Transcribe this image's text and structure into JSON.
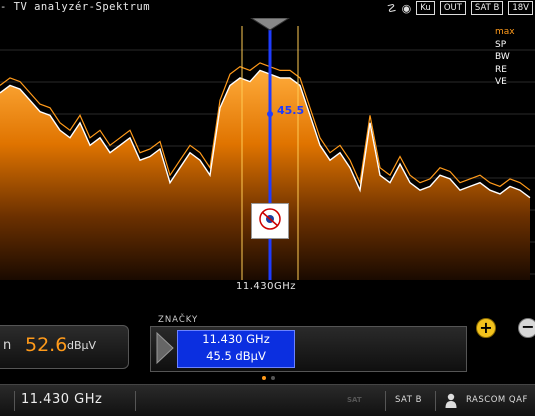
{
  "header": {
    "title": "- TV analyzér-Spektrum",
    "badges": [
      "Ku",
      "OUT",
      "SAT B",
      "18V"
    ]
  },
  "spectrum": {
    "center_frequency_label": "11.430GHz",
    "marker_readout": "45.5",
    "legend": [
      "max",
      "SP",
      "BW",
      "RE",
      "VE"
    ],
    "colors": {
      "fill": "#ff8c00",
      "max_trace": "#ff9a1a",
      "live_trace": "#ffffff",
      "marker": "#1e3cff"
    }
  },
  "level": {
    "prefix": "n",
    "value": "52.6",
    "unit": "dBµV"
  },
  "markers": {
    "label": "ZNAČKY",
    "frequency": "11.430 GHz",
    "level": "45.5 dBµV"
  },
  "footer": {
    "frequency": "11.430 GHz",
    "satellite": "SAT B",
    "operator": "RASCOM QAF"
  },
  "chart_data": {
    "type": "area",
    "x": [
      0,
      10,
      20,
      30,
      40,
      50,
      60,
      70,
      80,
      90,
      100,
      110,
      120,
      130,
      140,
      150,
      160,
      170,
      180,
      190,
      200,
      210,
      220,
      230,
      240,
      250,
      260,
      270,
      280,
      290,
      300,
      310,
      320,
      330,
      340,
      350,
      360,
      370,
      380,
      390,
      400,
      410,
      420,
      430,
      440,
      450,
      460,
      470,
      480,
      490,
      500,
      510,
      520,
      530
    ],
    "series": [
      {
        "values": [
          50,
          52,
          51,
          48,
          45,
          44,
          40,
          38,
          42,
          36,
          38,
          34,
          36,
          38,
          32,
          33,
          35,
          26,
          30,
          34,
          32,
          28,
          46,
          52,
          54,
          53,
          56,
          55,
          54,
          54,
          52,
          44,
          36,
          32,
          34,
          30,
          24,
          42,
          28,
          26,
          31,
          26,
          24,
          25,
          28,
          27,
          24,
          25,
          26,
          24,
          23,
          25,
          24,
          22
        ]
      },
      {
        "values": [
          52,
          54,
          53,
          50,
          47,
          46,
          42,
          40,
          44,
          38,
          40,
          36,
          38,
          40,
          34,
          35,
          37,
          28,
          32,
          36,
          34,
          30,
          48,
          55,
          57,
          56,
          58,
          57,
          56,
          56,
          54,
          46,
          38,
          34,
          36,
          32,
          26,
          44,
          30,
          28,
          33,
          28,
          26,
          27,
          30,
          29,
          26,
          27,
          28,
          26,
          25,
          27,
          26,
          24
        ]
      }
    ]
  }
}
